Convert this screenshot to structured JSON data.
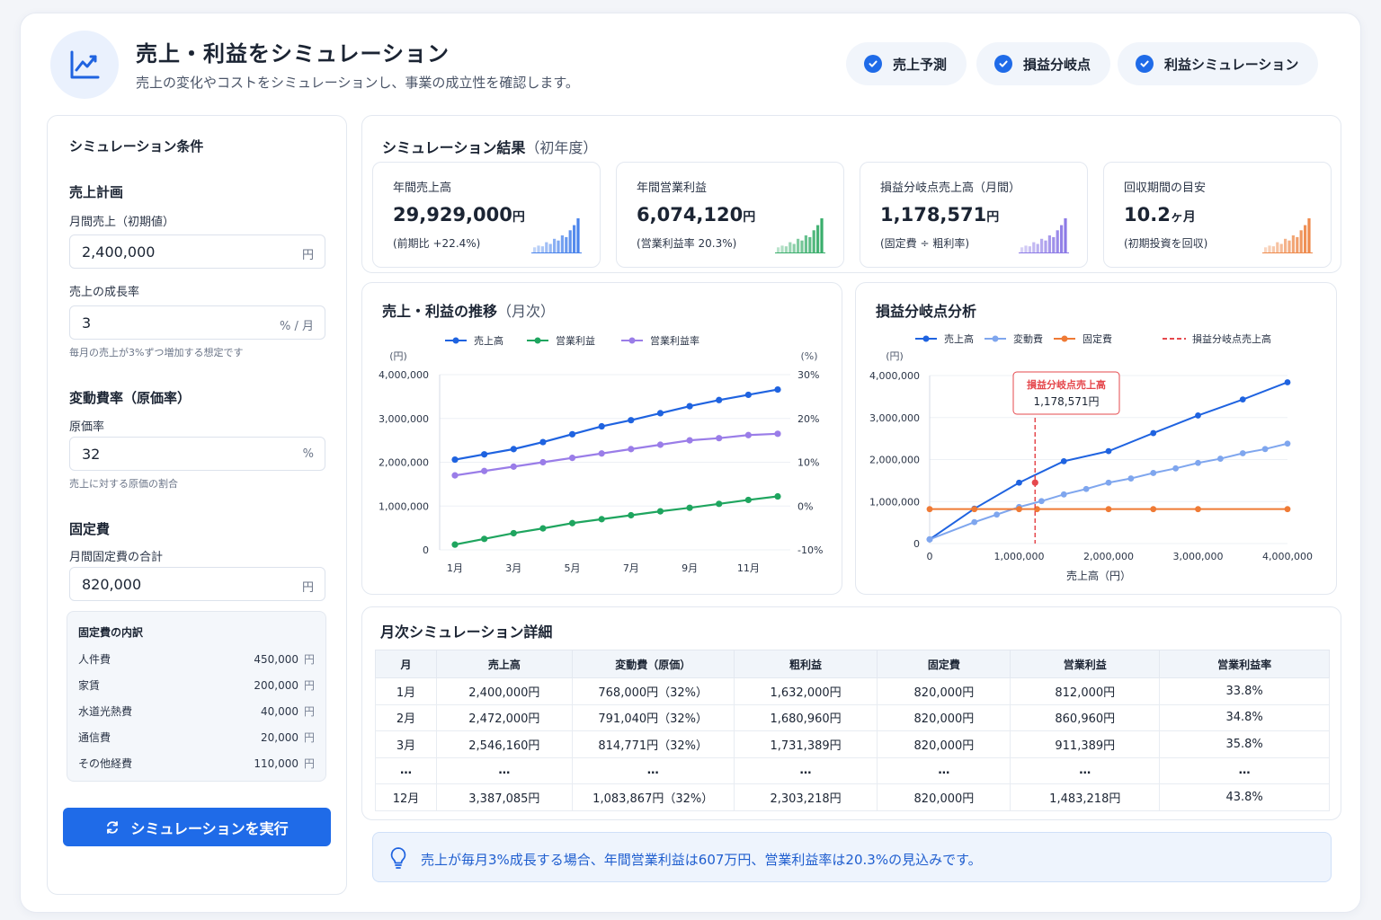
{
  "header": {
    "title": "売上・利益をシミュレーション",
    "subtitle": "売上の変化やコストをシミュレーションし、事業の成立性を確認します。",
    "pills": [
      "売上予測",
      "損益分岐点",
      "利益シミュレーション"
    ]
  },
  "conditions": {
    "title": "シミュレーション条件",
    "sales_plan": "売上計画",
    "monthly_sales_label": "月間売上（初期値）",
    "monthly_sales_value": "2,400,000",
    "monthly_sales_unit": "円",
    "growth_label": "売上の成長率",
    "growth_value": "3",
    "growth_unit": "% / 月",
    "growth_hint": "毎月の売上が3%ずつ増加する想定です",
    "variable_title": "変動費率（原価率）",
    "cost_rate_label": "原価率",
    "cost_rate_value": "32",
    "cost_rate_unit": "%",
    "cost_rate_hint": "売上に対する原価の割合",
    "fixed_title": "固定費",
    "fixed_total_label": "月間固定費の合計",
    "fixed_total_value": "820,000",
    "fixed_total_unit": "円",
    "breakdown_title": "固定費の内訳",
    "breakdown_unit": "円",
    "breakdown": [
      {
        "name": "人件費",
        "amount": "450,000"
      },
      {
        "name": "家賃",
        "amount": "200,000"
      },
      {
        "name": "水道光熱費",
        "amount": "40,000"
      },
      {
        "name": "通信費",
        "amount": "20,000"
      },
      {
        "name": "その他経費",
        "amount": "110,000"
      }
    ],
    "run_button": "シミュレーションを実行"
  },
  "results": {
    "title": "シミュレーション結果",
    "title_suffix": "（初年度）",
    "kpis": [
      {
        "title": "年間売上高",
        "value": "29,929,000",
        "unit": "円",
        "note": "(前期比 +22.4%)",
        "color": "#4a84ec"
      },
      {
        "title": "年間営業利益",
        "value": "6,074,120",
        "unit": "円",
        "note": "(営業利益率 20.3%)",
        "color": "#3aae6c"
      },
      {
        "title": "損益分岐点売上高（月間）",
        "value": "1,178,571",
        "unit": "円",
        "note": "(固定費 ÷ 粗利率)",
        "color": "#8c7ae6"
      },
      {
        "title": "回収期間の目安",
        "value": "10.2",
        "unit": "ヶ月",
        "note": "(初期投資を回収)",
        "color": "#ee8a4c"
      }
    ]
  },
  "trend_chart": {
    "title": "売上・利益の推移",
    "title_suffix": "（月次）",
    "legend": [
      "売上高",
      "営業利益",
      "営業利益率"
    ],
    "y_left_unit": "(円)",
    "y_right_unit": "(%)",
    "y_left_ticks": [
      "4,000,000",
      "3,000,000",
      "2,000,000",
      "1,000,000",
      "0"
    ],
    "y_right_ticks": [
      "30%",
      "20%",
      "10%",
      "0%",
      "-10%"
    ],
    "x_ticks": [
      "1月",
      "3月",
      "5月",
      "7月",
      "9月",
      "11月"
    ]
  },
  "bep_chart": {
    "title": "損益分岐点分析",
    "legend": [
      "売上高",
      "変動費",
      "固定費",
      "損益分岐点売上高"
    ],
    "y_unit": "(円)",
    "y_ticks": [
      "4,000,000",
      "3,000,000",
      "2,000,000",
      "1,000,000",
      "0"
    ],
    "x_ticks": [
      "0",
      "1,000,000",
      "2,000,000",
      "3,000,000",
      "4,000,000"
    ],
    "x_label": "売上高（円）",
    "annotation_title": "損益分岐点売上高",
    "annotation_value": "1,178,571円"
  },
  "chart_data": [
    {
      "type": "line",
      "x": [
        "1月",
        "2月",
        "3月",
        "4月",
        "5月",
        "6月",
        "7月",
        "8月",
        "9月",
        "10月",
        "11月",
        "12月"
      ],
      "series": [
        {
          "name": "売上高",
          "axis": "left",
          "color": "#1f63e0",
          "values": [
            2060000,
            2180000,
            2300000,
            2460000,
            2640000,
            2820000,
            2960000,
            3120000,
            3280000,
            3420000,
            3540000,
            3660000
          ]
        },
        {
          "name": "営業利益",
          "axis": "left",
          "color": "#1fa55f",
          "values": [
            120000,
            250000,
            380000,
            490000,
            610000,
            700000,
            790000,
            880000,
            960000,
            1050000,
            1140000,
            1220000
          ]
        },
        {
          "name": "営業利益率",
          "axis": "right",
          "color": "#9a7de8",
          "values": [
            7,
            8,
            9,
            10,
            11,
            12,
            13,
            14,
            15,
            15.5,
            16.2,
            16.5
          ]
        }
      ],
      "ylim_left": [
        0,
        4000000
      ],
      "ylim_right": [
        -10,
        30
      ]
    },
    {
      "type": "line",
      "x_range": [
        0,
        4000000
      ],
      "ylim": [
        0,
        4000000
      ],
      "series": [
        {
          "name": "売上高",
          "color": "#1f63e0",
          "points": [
            [
              0,
              100000
            ],
            [
              500000,
              830000
            ],
            [
              1000000,
              1450000
            ],
            [
              1500000,
              1960000
            ],
            [
              2000000,
              2200000
            ],
            [
              2500000,
              2630000
            ],
            [
              3000000,
              3050000
            ],
            [
              3500000,
              3430000
            ],
            [
              4000000,
              3840000
            ]
          ]
        },
        {
          "name": "変動費",
          "color": "#7fa6ee",
          "points": [
            [
              0,
              100000
            ],
            [
              500000,
              510000
            ],
            [
              750000,
              690000
            ],
            [
              1000000,
              870000
            ],
            [
              1250000,
              1010000
            ],
            [
              1500000,
              1170000
            ],
            [
              1750000,
              1300000
            ],
            [
              2000000,
              1450000
            ],
            [
              2250000,
              1550000
            ],
            [
              2500000,
              1680000
            ],
            [
              2750000,
              1790000
            ],
            [
              3000000,
              1920000
            ],
            [
              3250000,
              2020000
            ],
            [
              3500000,
              2150000
            ],
            [
              3750000,
              2250000
            ],
            [
              4000000,
              2380000
            ]
          ]
        },
        {
          "name": "固定費",
          "color": "#ef7a35",
          "points": [
            [
              0,
              820000
            ],
            [
              500000,
              820000
            ],
            [
              1000000,
              820000
            ],
            [
              1200000,
              820000
            ],
            [
              2000000,
              820000
            ],
            [
              2500000,
              820000
            ],
            [
              3000000,
              820000
            ],
            [
              4000000,
              820000
            ]
          ]
        }
      ],
      "bep_x": 1178571
    }
  ],
  "table": {
    "title": "月次シミュレーション詳細",
    "headers": [
      "月",
      "売上高",
      "変動費（原価）",
      "粗利益",
      "固定費",
      "営業利益",
      "営業利益率"
    ],
    "rows": [
      [
        "1月",
        "2,400,000円",
        "768,000円（32%）",
        "1,632,000円",
        "820,000円",
        "812,000円",
        "33.8%"
      ],
      [
        "2月",
        "2,472,000円",
        "791,040円（32%）",
        "1,680,960円",
        "820,000円",
        "860,960円",
        "34.8%"
      ],
      [
        "3月",
        "2,546,160円",
        "814,771円（32%）",
        "1,731,389円",
        "820,000円",
        "911,389円",
        "35.8%"
      ],
      [
        "…",
        "…",
        "…",
        "…",
        "…",
        "…",
        "…"
      ],
      [
        "12月",
        "3,387,085円",
        "1,083,867円（32%）",
        "2,303,218円",
        "820,000円",
        "1,483,218円",
        "43.8%"
      ]
    ]
  },
  "note": "売上が毎月3%成長する場合、年間営業利益は607万円、営業利益率は20.3%の見込みです。"
}
